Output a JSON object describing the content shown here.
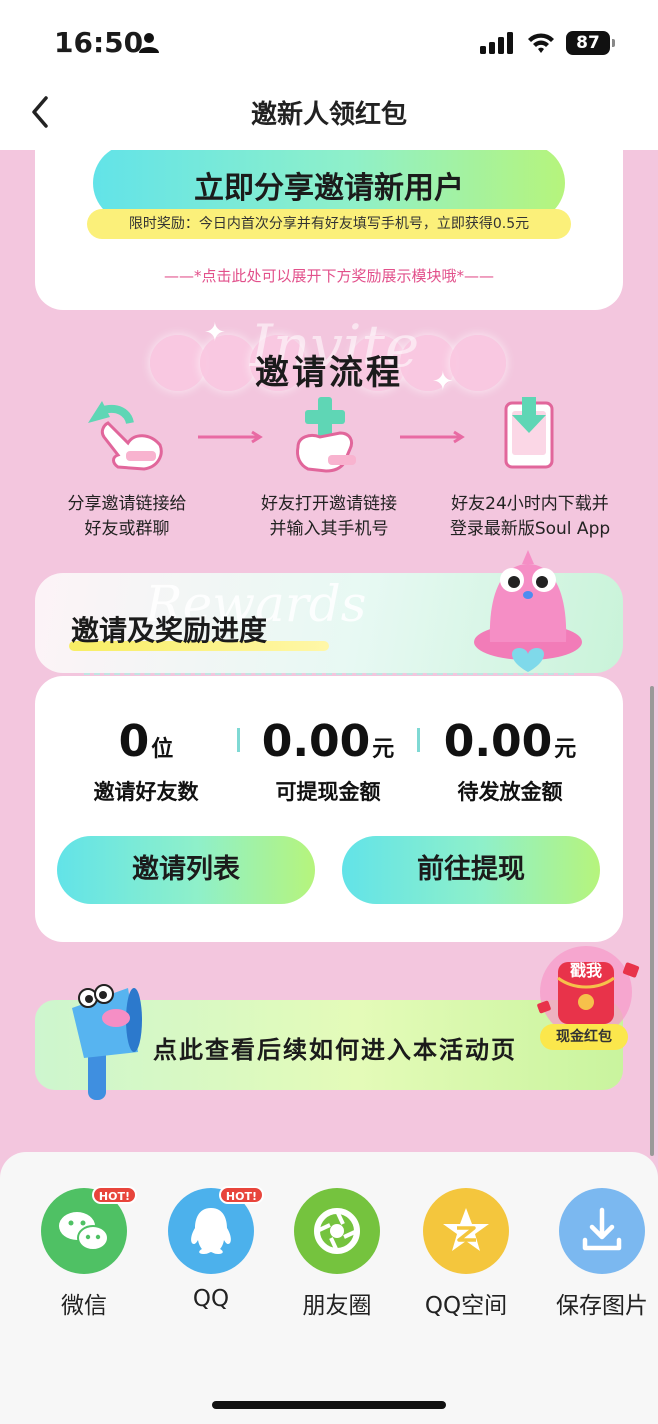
{
  "status_bar": {
    "time": "16:50",
    "battery": "87"
  },
  "nav": {
    "title": "邀新人领红包"
  },
  "share_card": {
    "button_label": "立即分享邀请新用户",
    "limit_tip": "限时奖励：今日内首次分享并有好友填写手机号，立即获得0.5元",
    "expand_hint": "——*点击此处可以展开下方奖励展示模块哦*——"
  },
  "process": {
    "bg_text": "Invite",
    "title": "邀请流程",
    "steps": [
      {
        "line1": "分享邀请链接给",
        "line2": "好友或群聊"
      },
      {
        "line1": "好友打开邀请链接",
        "line2": "并输入其手机号"
      },
      {
        "line1": "好友24小时内下载并",
        "line2": "登录最新版Soul App"
      }
    ]
  },
  "progress": {
    "bg_text": "Rewards",
    "title": "邀请及奖励进度",
    "stats": [
      {
        "value": "0",
        "unit": "位",
        "label": "邀请好友数"
      },
      {
        "value": "0.00",
        "unit": "元",
        "label": "可提现金额"
      },
      {
        "value": "0.00",
        "unit": "元",
        "label": "待发放金额"
      }
    ],
    "invite_list_label": "邀请列表",
    "withdraw_label": "前往提现"
  },
  "activity": {
    "banner_text": "点此查看后续如何进入本活动页",
    "redpacket_badge": "戳我",
    "redpacket_label": "现金红包"
  },
  "share_sheet": {
    "hot_badge": "HOT!",
    "items": [
      {
        "label": "微信",
        "icon": "wechat-icon",
        "color": "#4fc164"
      },
      {
        "label": "QQ",
        "icon": "qq-icon",
        "color": "#4cb1ec"
      },
      {
        "label": "朋友圈",
        "icon": "moments-icon",
        "color": "#75c33e"
      },
      {
        "label": "QQ空间",
        "icon": "qzone-icon",
        "color": "#f4c63d"
      },
      {
        "label": "保存图片",
        "icon": "download-icon",
        "color": "#7bb8f0"
      }
    ]
  }
}
